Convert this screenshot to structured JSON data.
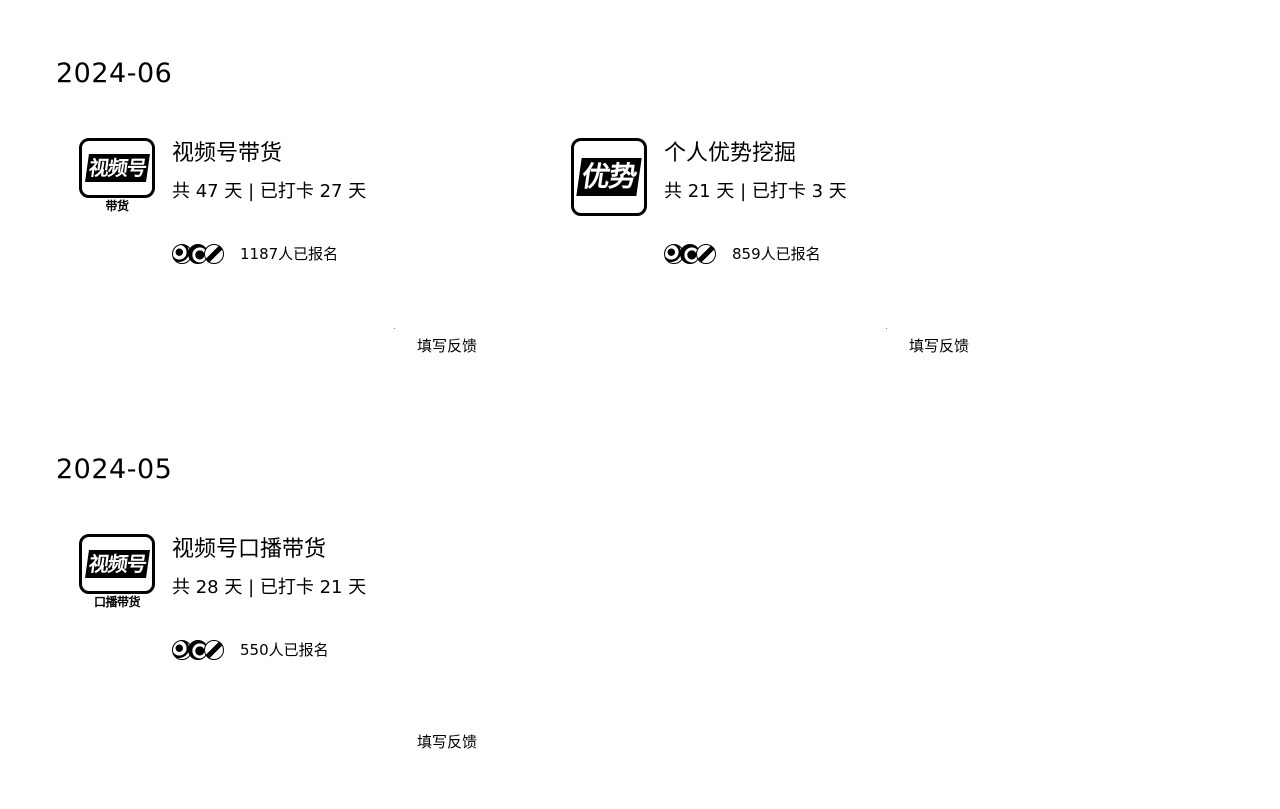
{
  "sections": [
    {
      "month": "2024-06",
      "cards": [
        {
          "icon_text": "视频号",
          "icon_sub": "带货",
          "title": "视频号带货",
          "meta": "共 47 天 | 已打卡 27 天",
          "enrolled": "1187人已报名",
          "feedback": "填写反馈"
        },
        {
          "icon_text": "优势",
          "icon_sub": "",
          "title": "个人优势挖掘",
          "meta": "共 21 天 | 已打卡 3 天",
          "enrolled": "859人已报名",
          "feedback": "填写反馈"
        }
      ]
    },
    {
      "month": "2024-05",
      "cards": [
        {
          "icon_text": "视频号",
          "icon_sub": "口播带货",
          "title": "视频号口播带货",
          "meta": "共 28 天 | 已打卡 21 天",
          "enrolled": "550人已报名",
          "feedback": "填写反馈"
        }
      ]
    }
  ]
}
